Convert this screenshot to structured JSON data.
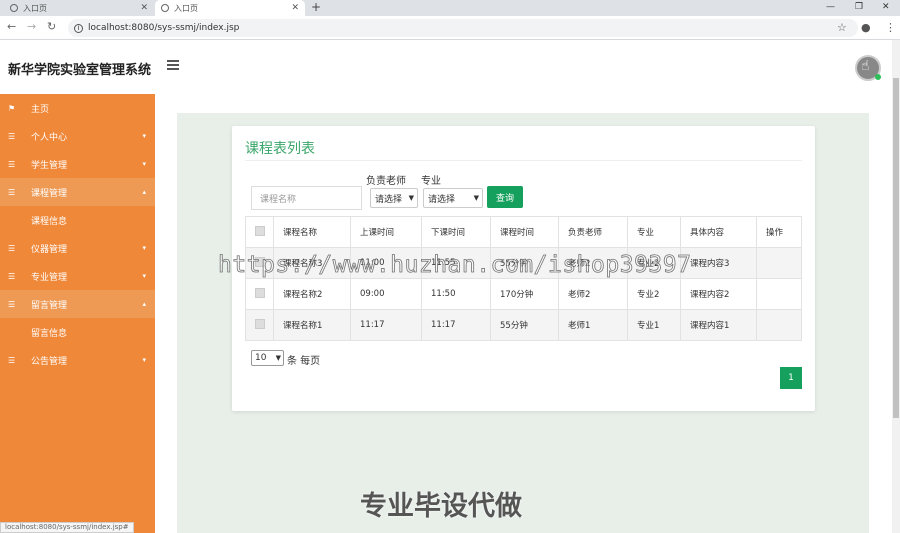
{
  "browser": {
    "tabs": [
      {
        "title": "入口页"
      },
      {
        "title": "入口页"
      }
    ],
    "url": "localhost:8080/sys-ssmj/index.jsp",
    "status_url": "localhost:8080/sys-ssmj/index.jsp#"
  },
  "header": {
    "title": "新华学院实验室管理系统"
  },
  "sidebar": {
    "items": [
      {
        "label": "主页",
        "icon": "flag-icon"
      },
      {
        "label": "个人中心",
        "icon": "list-icon"
      },
      {
        "label": "学生管理",
        "icon": "list-icon"
      },
      {
        "label": "课程管理",
        "icon": "list-icon"
      },
      {
        "label": "课程信息"
      },
      {
        "label": "仪器管理",
        "icon": "list-icon"
      },
      {
        "label": "专业管理",
        "icon": "list-icon"
      },
      {
        "label": "留言管理",
        "icon": "list-icon"
      },
      {
        "label": "留言信息"
      },
      {
        "label": "公告管理",
        "icon": "list-icon"
      }
    ]
  },
  "main": {
    "title": "课程表列表",
    "filters": {
      "name_placeholder": "课程名称",
      "teacher_label": "负责老师",
      "teacher_value": "请选择",
      "major_label": "专业",
      "major_value": "请选择",
      "query_label": "查询"
    },
    "table": {
      "headers": [
        "课程名称",
        "上课时间",
        "下课时间",
        "课程时间",
        "负责老师",
        "专业",
        "具体内容",
        "操作"
      ],
      "rows": [
        [
          "课程名称3",
          "11:00",
          "11:55",
          "55分钟",
          "老师2",
          "专业2",
          "课程内容3"
        ],
        [
          "课程名称2",
          "09:00",
          "11:50",
          "170分钟",
          "老师2",
          "专业2",
          "课程内容2"
        ],
        [
          "课程名称1",
          "11:17",
          "11:17",
          "55分钟",
          "老师1",
          "专业1",
          "课程内容1"
        ]
      ]
    },
    "pagination": {
      "page_size": "10",
      "page_size_label": "条 每页",
      "current_page": "1"
    }
  },
  "overlay": {
    "watermark": "https://www.huzhan.com/ishop39397",
    "bottom_text": "专业毕设代做"
  },
  "colors": {
    "sidebar": "#f0883a",
    "accent": "#16a05d",
    "title": "#3aa66a"
  }
}
